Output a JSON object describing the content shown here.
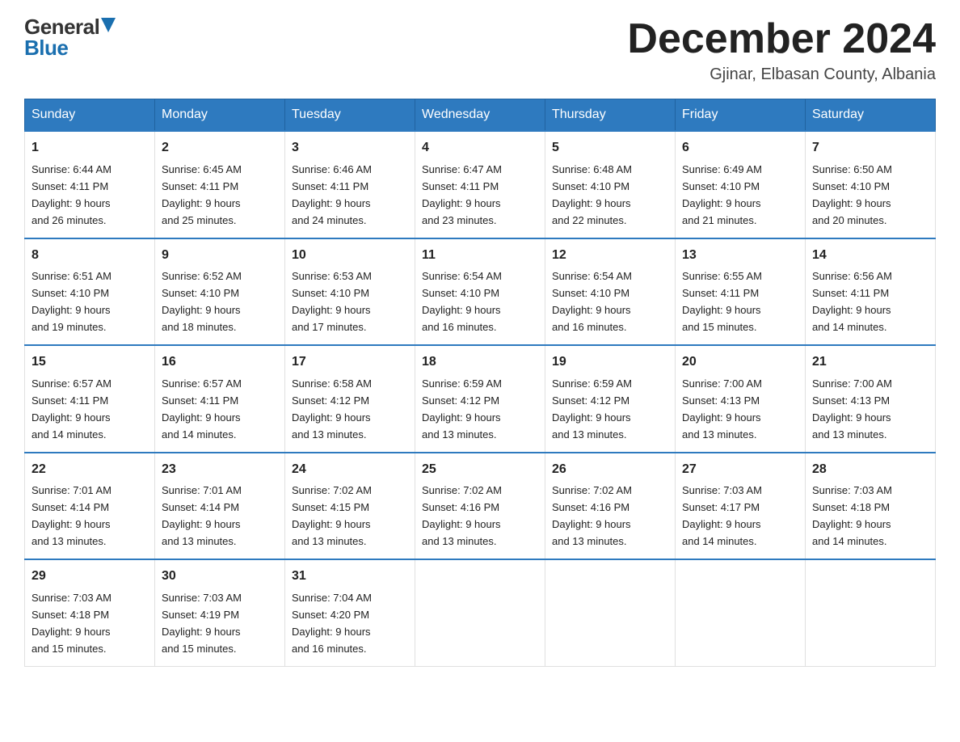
{
  "header": {
    "logo_general": "General",
    "logo_blue": "Blue",
    "title": "December 2024",
    "location": "Gjinar, Elbasan County, Albania"
  },
  "days_of_week": [
    "Sunday",
    "Monday",
    "Tuesday",
    "Wednesday",
    "Thursday",
    "Friday",
    "Saturday"
  ],
  "weeks": [
    [
      {
        "day": "1",
        "sunrise": "Sunrise: 6:44 AM",
        "sunset": "Sunset: 4:11 PM",
        "daylight": "Daylight: 9 hours",
        "daylight2": "and 26 minutes."
      },
      {
        "day": "2",
        "sunrise": "Sunrise: 6:45 AM",
        "sunset": "Sunset: 4:11 PM",
        "daylight": "Daylight: 9 hours",
        "daylight2": "and 25 minutes."
      },
      {
        "day": "3",
        "sunrise": "Sunrise: 6:46 AM",
        "sunset": "Sunset: 4:11 PM",
        "daylight": "Daylight: 9 hours",
        "daylight2": "and 24 minutes."
      },
      {
        "day": "4",
        "sunrise": "Sunrise: 6:47 AM",
        "sunset": "Sunset: 4:11 PM",
        "daylight": "Daylight: 9 hours",
        "daylight2": "and 23 minutes."
      },
      {
        "day": "5",
        "sunrise": "Sunrise: 6:48 AM",
        "sunset": "Sunset: 4:10 PM",
        "daylight": "Daylight: 9 hours",
        "daylight2": "and 22 minutes."
      },
      {
        "day": "6",
        "sunrise": "Sunrise: 6:49 AM",
        "sunset": "Sunset: 4:10 PM",
        "daylight": "Daylight: 9 hours",
        "daylight2": "and 21 minutes."
      },
      {
        "day": "7",
        "sunrise": "Sunrise: 6:50 AM",
        "sunset": "Sunset: 4:10 PM",
        "daylight": "Daylight: 9 hours",
        "daylight2": "and 20 minutes."
      }
    ],
    [
      {
        "day": "8",
        "sunrise": "Sunrise: 6:51 AM",
        "sunset": "Sunset: 4:10 PM",
        "daylight": "Daylight: 9 hours",
        "daylight2": "and 19 minutes."
      },
      {
        "day": "9",
        "sunrise": "Sunrise: 6:52 AM",
        "sunset": "Sunset: 4:10 PM",
        "daylight": "Daylight: 9 hours",
        "daylight2": "and 18 minutes."
      },
      {
        "day": "10",
        "sunrise": "Sunrise: 6:53 AM",
        "sunset": "Sunset: 4:10 PM",
        "daylight": "Daylight: 9 hours",
        "daylight2": "and 17 minutes."
      },
      {
        "day": "11",
        "sunrise": "Sunrise: 6:54 AM",
        "sunset": "Sunset: 4:10 PM",
        "daylight": "Daylight: 9 hours",
        "daylight2": "and 16 minutes."
      },
      {
        "day": "12",
        "sunrise": "Sunrise: 6:54 AM",
        "sunset": "Sunset: 4:10 PM",
        "daylight": "Daylight: 9 hours",
        "daylight2": "and 16 minutes."
      },
      {
        "day": "13",
        "sunrise": "Sunrise: 6:55 AM",
        "sunset": "Sunset: 4:11 PM",
        "daylight": "Daylight: 9 hours",
        "daylight2": "and 15 minutes."
      },
      {
        "day": "14",
        "sunrise": "Sunrise: 6:56 AM",
        "sunset": "Sunset: 4:11 PM",
        "daylight": "Daylight: 9 hours",
        "daylight2": "and 14 minutes."
      }
    ],
    [
      {
        "day": "15",
        "sunrise": "Sunrise: 6:57 AM",
        "sunset": "Sunset: 4:11 PM",
        "daylight": "Daylight: 9 hours",
        "daylight2": "and 14 minutes."
      },
      {
        "day": "16",
        "sunrise": "Sunrise: 6:57 AM",
        "sunset": "Sunset: 4:11 PM",
        "daylight": "Daylight: 9 hours",
        "daylight2": "and 14 minutes."
      },
      {
        "day": "17",
        "sunrise": "Sunrise: 6:58 AM",
        "sunset": "Sunset: 4:12 PM",
        "daylight": "Daylight: 9 hours",
        "daylight2": "and 13 minutes."
      },
      {
        "day": "18",
        "sunrise": "Sunrise: 6:59 AM",
        "sunset": "Sunset: 4:12 PM",
        "daylight": "Daylight: 9 hours",
        "daylight2": "and 13 minutes."
      },
      {
        "day": "19",
        "sunrise": "Sunrise: 6:59 AM",
        "sunset": "Sunset: 4:12 PM",
        "daylight": "Daylight: 9 hours",
        "daylight2": "and 13 minutes."
      },
      {
        "day": "20",
        "sunrise": "Sunrise: 7:00 AM",
        "sunset": "Sunset: 4:13 PM",
        "daylight": "Daylight: 9 hours",
        "daylight2": "and 13 minutes."
      },
      {
        "day": "21",
        "sunrise": "Sunrise: 7:00 AM",
        "sunset": "Sunset: 4:13 PM",
        "daylight": "Daylight: 9 hours",
        "daylight2": "and 13 minutes."
      }
    ],
    [
      {
        "day": "22",
        "sunrise": "Sunrise: 7:01 AM",
        "sunset": "Sunset: 4:14 PM",
        "daylight": "Daylight: 9 hours",
        "daylight2": "and 13 minutes."
      },
      {
        "day": "23",
        "sunrise": "Sunrise: 7:01 AM",
        "sunset": "Sunset: 4:14 PM",
        "daylight": "Daylight: 9 hours",
        "daylight2": "and 13 minutes."
      },
      {
        "day": "24",
        "sunrise": "Sunrise: 7:02 AM",
        "sunset": "Sunset: 4:15 PM",
        "daylight": "Daylight: 9 hours",
        "daylight2": "and 13 minutes."
      },
      {
        "day": "25",
        "sunrise": "Sunrise: 7:02 AM",
        "sunset": "Sunset: 4:16 PM",
        "daylight": "Daylight: 9 hours",
        "daylight2": "and 13 minutes."
      },
      {
        "day": "26",
        "sunrise": "Sunrise: 7:02 AM",
        "sunset": "Sunset: 4:16 PM",
        "daylight": "Daylight: 9 hours",
        "daylight2": "and 13 minutes."
      },
      {
        "day": "27",
        "sunrise": "Sunrise: 7:03 AM",
        "sunset": "Sunset: 4:17 PM",
        "daylight": "Daylight: 9 hours",
        "daylight2": "and 14 minutes."
      },
      {
        "day": "28",
        "sunrise": "Sunrise: 7:03 AM",
        "sunset": "Sunset: 4:18 PM",
        "daylight": "Daylight: 9 hours",
        "daylight2": "and 14 minutes."
      }
    ],
    [
      {
        "day": "29",
        "sunrise": "Sunrise: 7:03 AM",
        "sunset": "Sunset: 4:18 PM",
        "daylight": "Daylight: 9 hours",
        "daylight2": "and 15 minutes."
      },
      {
        "day": "30",
        "sunrise": "Sunrise: 7:03 AM",
        "sunset": "Sunset: 4:19 PM",
        "daylight": "Daylight: 9 hours",
        "daylight2": "and 15 minutes."
      },
      {
        "day": "31",
        "sunrise": "Sunrise: 7:04 AM",
        "sunset": "Sunset: 4:20 PM",
        "daylight": "Daylight: 9 hours",
        "daylight2": "and 16 minutes."
      },
      null,
      null,
      null,
      null
    ]
  ]
}
